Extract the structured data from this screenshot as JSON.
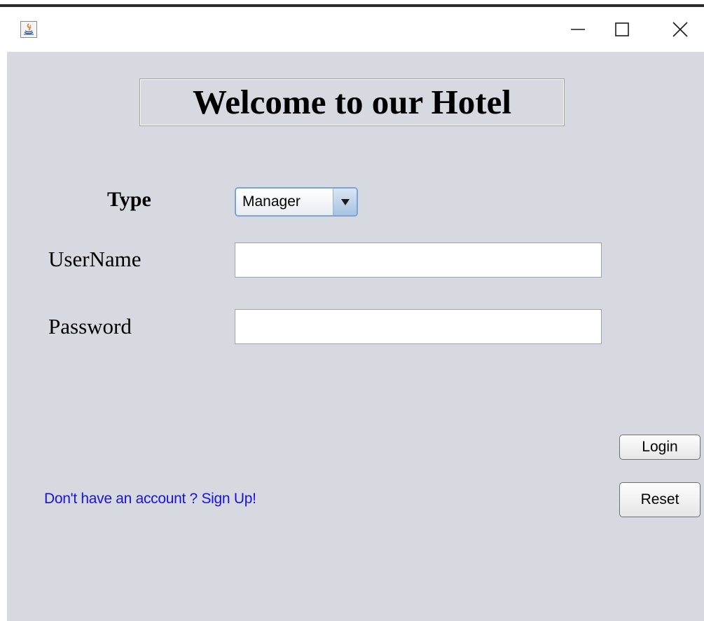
{
  "window": {
    "icon": "java-app-icon",
    "controls": [
      "minimize-icon",
      "maximize-icon",
      "close-icon"
    ]
  },
  "form": {
    "heading": "Welcome to our Hotel",
    "type_label": "Type",
    "type_value": "Manager",
    "username_label": "UserName",
    "username_value": "",
    "password_label": "Password",
    "password_value": ""
  },
  "actions": {
    "login_label": "Login",
    "reset_label": "Reset",
    "signup_link": "Don't have an account ? Sign Up!"
  },
  "colors": {
    "background": "#d6d9e0",
    "link": "#1c12d8",
    "combo_border": "#7aa4d6"
  }
}
